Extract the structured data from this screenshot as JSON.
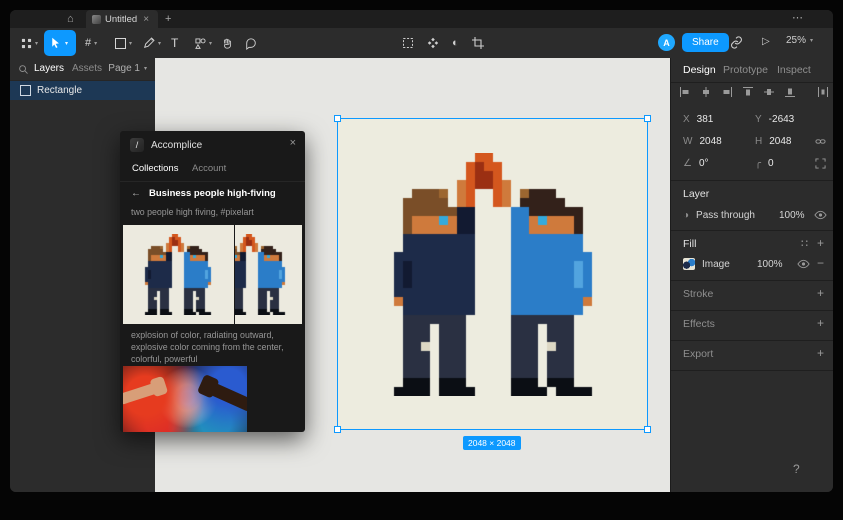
{
  "colors": {
    "accent": "#0d99ff",
    "canvas_bg": "#e6e6e3",
    "artboard_bg": "#edecdf",
    "panel_bg": "#2c2c2c",
    "selection_blue": "#0d99ff"
  },
  "icons": {
    "home": "⌂",
    "plus": "+",
    "close": "×",
    "more": "⋯",
    "chevron": "▾",
    "back": "←",
    "frame": "#",
    "text_tool": "T",
    "mask": "◐",
    "styles": "∷",
    "minus": "−",
    "rotation": "∠",
    "radius": "╭",
    "blend": "◑",
    "present": "▷",
    "plugin_logo": "/"
  },
  "tabbar": {
    "file_title": "Untitled"
  },
  "toolbar": {
    "share_label": "Share",
    "zoom_level": "25%",
    "avatar_initial": "A"
  },
  "left_panel": {
    "tab_layers": "Layers",
    "tab_assets": "Assets",
    "page_selector": "Page 1",
    "layers": [
      {
        "name": "Rectangle"
      }
    ]
  },
  "canvas": {
    "selection_dimensions": "2048 × 2048"
  },
  "plugin": {
    "title": "Accomplice",
    "tab_collections": "Collections",
    "tab_account": "Account",
    "collection_title": "Business people high-fiving",
    "prompt_1": "two people high fiving, #pixelart",
    "prompt_2": "explosion of color, radiating outward, explosive color coming from the center, colorful, powerful"
  },
  "inspector": {
    "tab_design": "Design",
    "tab_prototype": "Prototype",
    "tab_inspect": "Inspect",
    "x_label": "X",
    "x_value": "381",
    "y_label": "Y",
    "y_value": "-2643",
    "w_label": "W",
    "w_value": "2048",
    "h_label": "H",
    "h_value": "2048",
    "rotation_value": "0°",
    "radius_value": "0",
    "layer_section": "Layer",
    "blend_mode": "Pass through",
    "layer_opacity": "100%",
    "fill_section": "Fill",
    "fill_type": "Image",
    "fill_opacity": "100%",
    "stroke_section": "Stroke",
    "effects_section": "Effects",
    "export_section": "Export",
    "help": "?"
  },
  "pixel_art": {
    "palette": {
      "o": "#d4571e",
      "r": "#9b2f12",
      "s": "#cf7a3c",
      "h": "#7a4e28",
      "g": "#9c6630",
      "H": "#33211a",
      "e": "#35aadc",
      "B": "#1d2b49",
      "N": "#121a31",
      "b": "#2b7dc8",
      "c": "#52a4df",
      "d": "#2a3042",
      "k": "#0b0e14",
      "w": "#ddd8c4"
    },
    "rows": [
      "...........oo.............",
      "..........oroo............",
      "..........orro............",
      ".........sorros...........",
      "....hhhg.so..os.gHHH......",
      "...hhhhh.so..os.HHHHH.....",
      "...hhhhhhNN....bbHHHHHH...",
      "...hsssesNN....bbsesssH...",
      "...hsssssNN....bbsssssH...",
      "...BBBBBBBB....bbbbbbbb...",
      "...BBBBBBBB....bbbbbbbb...",
      "..BBBBBBBBB....bbbbbbbbb..",
      "..BNBBBBBBB....bbbbbbbcb..",
      "..BNBBBBBBB....bbbbbbbcb..",
      "..BNBBBBBBB....bbbbbbbcb..",
      "..BBBBBBBBB....bbbbbbbbb..",
      "..sBBBBBBBB....bbbbbbbbs..",
      "...BBBBBBBB....bbbbbbbb...",
      "...ddddddd.....ddddddd....",
      "...ddd.ddd.....ddd.ddd....",
      "...ddd.ddd.....ddd.ddd....",
      "...ddw.ddd.....ddd.wdd....",
      "...ddd.ddd.....ddd.ddd....",
      "...ddd.ddd.....ddd.ddd....",
      "...ddd.ddd.....ddd.ddd....",
      "...kkk.kkk.....kkk.kkk....",
      "..kkkk.kkkk....kkkk.kkkk.."
    ]
  }
}
